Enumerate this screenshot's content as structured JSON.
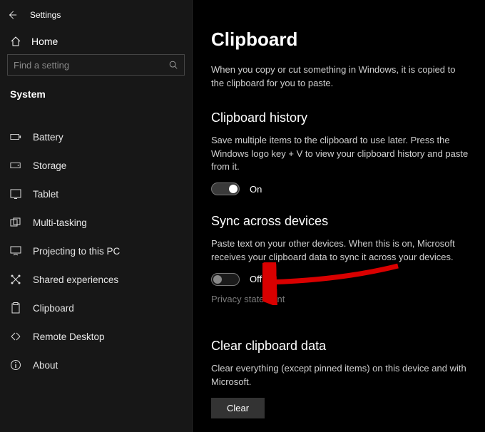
{
  "header": {
    "title": "Settings"
  },
  "home": {
    "label": "Home"
  },
  "search": {
    "placeholder": "Find a setting"
  },
  "section": {
    "label": "System"
  },
  "nav": {
    "items": [
      {
        "label": "Battery"
      },
      {
        "label": "Storage"
      },
      {
        "label": "Tablet"
      },
      {
        "label": "Multi-tasking"
      },
      {
        "label": "Projecting to this PC"
      },
      {
        "label": "Shared experiences"
      },
      {
        "label": "Clipboard"
      },
      {
        "label": "Remote Desktop"
      },
      {
        "label": "About"
      }
    ]
  },
  "main": {
    "title": "Clipboard",
    "intro": "When you copy or cut something in Windows, it is copied to the clipboard for you to paste.",
    "history": {
      "heading": "Clipboard history",
      "desc": "Save multiple items to the clipboard to use later. Press the Windows logo key + V to view your clipboard history and paste from it.",
      "toggle_label": "On"
    },
    "sync": {
      "heading": "Sync across devices",
      "desc": "Paste text on your other devices. When this is on, Microsoft receives your clipboard data to sync it across your devices.",
      "toggle_label": "Off",
      "privacy_link": "Privacy statement"
    },
    "clear": {
      "heading": "Clear clipboard data",
      "desc": "Clear everything (except pinned items) on this device and with Microsoft.",
      "button": "Clear"
    }
  }
}
